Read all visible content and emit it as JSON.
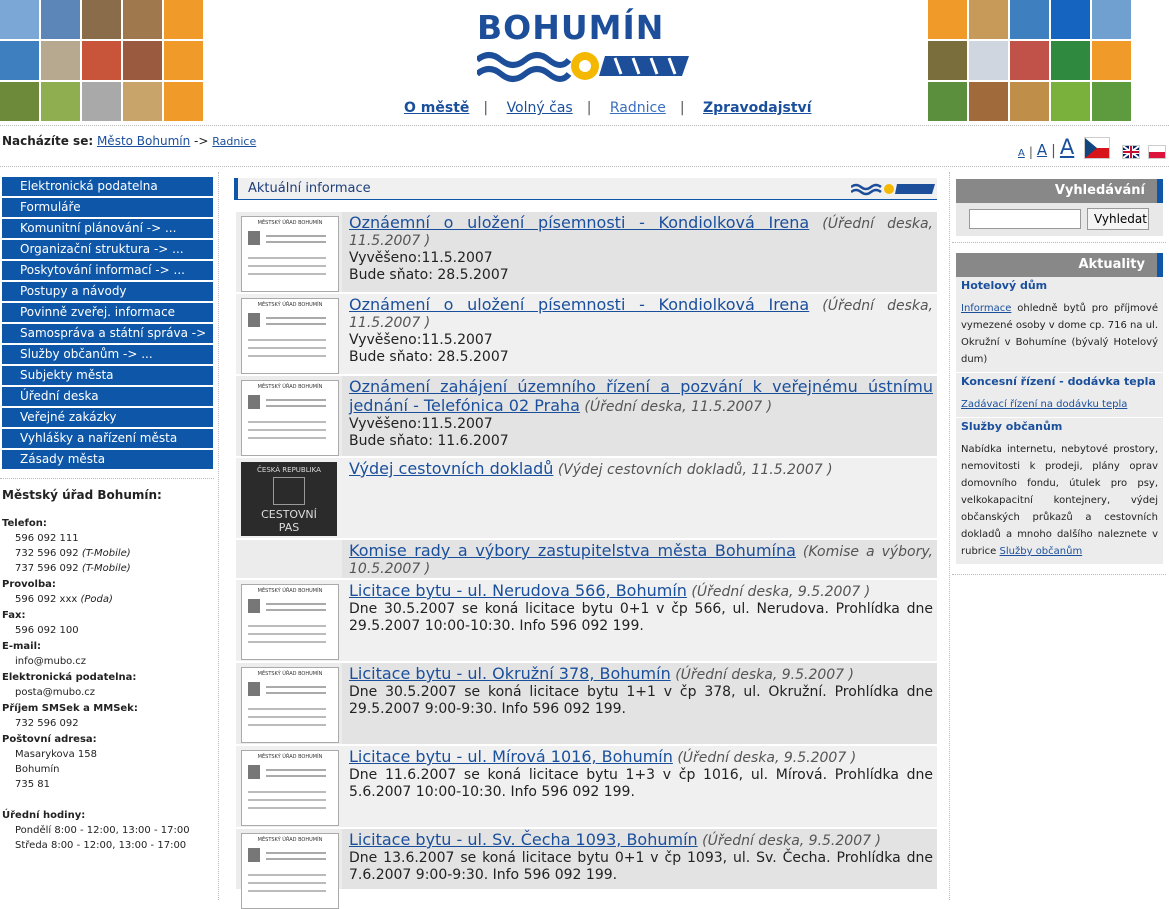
{
  "header": {
    "logo_text": "BOHUMÍN",
    "nav": [
      {
        "label": "O městě"
      },
      {
        "label": "Volný čas"
      },
      {
        "label": "Radnice"
      },
      {
        "label": "Zpravodajství"
      }
    ]
  },
  "breadcrumb": {
    "prefix": "Nacházíte se:",
    "items": [
      "Město Bohumín",
      "Radnice"
    ],
    "separator": "->"
  },
  "font_size_controls": [
    "A",
    "A",
    "A"
  ],
  "left_menu": [
    "Elektronická podatelna",
    "Formuláře",
    "Komunitní plánování  -> ...",
    "Organizační struktura  -> ...",
    "Poskytování informací  -> ...",
    "Postupy a návody",
    "Povinně zveřej. informace",
    "Samospráva a státní správa  ->",
    "Služby občanům  -> ...",
    "Subjekty města",
    "Úřední deska",
    "Veřejné zakázky",
    "Vyhlášky a nařízení města",
    "Zásady města"
  ],
  "contact": {
    "title": "Městský úřad Bohumín:",
    "telefon_label": "Telefon:",
    "telefon": [
      "596 092 111",
      "732 596 092",
      "737 596 092"
    ],
    "telefon_note": "(T-Mobile)",
    "provolba_label": "Provolba:",
    "provolba": "596 092 xxx",
    "provolba_note": "(Poda)",
    "fax_label": "Fax:",
    "fax": "596 092 100",
    "email_label": "E-mail:",
    "email": "info@mubo.cz",
    "podatelna_label": "Elektronická podatelna:",
    "podatelna": "posta@mubo.cz",
    "sms_label": "Příjem SMSek a MMSek:",
    "sms": "732 596 092",
    "address_label": "Poštovní adresa:",
    "address": [
      "Masarykova 158",
      "Bohumín",
      "735 81"
    ],
    "hours_label": "Úřední hodiny:",
    "hours": [
      "Pondělí 8:00 - 12:00, 13:00 - 17:00",
      "Středa 8:00 - 12:00, 13:00 - 17:00"
    ]
  },
  "main": {
    "heading": "Aktuální informace",
    "news": [
      {
        "title": "Oznáemní o uložení písemnosti - Kondiolková Irena",
        "meta": "(Úřední deska, 11.5.2007 )",
        "lines": [
          "Vyvěšeno:11.5.2007",
          "Bude sňato: 28.5.2007"
        ],
        "thumb": "doc"
      },
      {
        "title": "Oznámení o uložení písemnosti - Kondiolková Irena",
        "meta": "(Úřední deska, 11.5.2007 )",
        "lines": [
          "Vyvěšeno:11.5.2007",
          "Bude sňato: 28.5.2007"
        ],
        "thumb": "doc"
      },
      {
        "title": "Oznámení zahájení územního řízení a pozvání k veřejnému ústnímu jednání - Telefónica 02 Praha",
        "meta": "(Úřední deska, 11.5.2007 )",
        "lines": [
          "Vyvěšeno:11.5.2007",
          "Bude sňato: 11.6.2007"
        ],
        "thumb": "doc"
      },
      {
        "title": "Výdej cestovních dokladů",
        "meta": "(Výdej cestovních dokladů, 11.5.2007 )",
        "lines": [],
        "thumb": "pas"
      },
      {
        "title": "Komise rady a výbory zastupitelstva města Bohumína",
        "meta": "(Komise a výbory, 10.5.2007 )",
        "lines": [],
        "thumb": "none"
      },
      {
        "title": "Licitace bytu - ul. Nerudova 566, Bohumín",
        "meta": "(Úřední deska, 9.5.2007 )",
        "lines": [
          "Dne 30.5.2007 se koná licitace bytu 0+1 v čp 566, ul. Nerudova. Prohlídka dne 29.5.2007 10:00-10:30. Info 596 092 199."
        ],
        "thumb": "doc"
      },
      {
        "title": "Licitace bytu - ul. Okružní 378, Bohumín",
        "meta": "(Úřední deska, 9.5.2007 )",
        "lines": [
          "Dne 30.5.2007 se koná licitace bytu 1+1 v čp 378, ul. Okružní. Prohlídka dne 29.5.2007 9:00-9:30. Info 596 092 199."
        ],
        "thumb": "doc"
      },
      {
        "title": "Licitace bytu - ul. Mírová 1016, Bohumín",
        "meta": "(Úřední deska, 9.5.2007 )",
        "lines": [
          "Dne 11.6.2007 se koná licitace bytu 1+3 v čp 1016, ul. Mírová. Prohlídka dne 5.6.2007 10:00-10:30. Info 596 092 199."
        ],
        "thumb": "doc"
      },
      {
        "title": "Licitace bytu - ul. Sv. Čecha 1093, Bohumín",
        "meta": "(Úřední deska, 9.5.2007 )",
        "lines": [
          "Dne 13.6.2007 se koná licitace bytu 0+1 v čp 1093, ul. Sv. Čecha. Prohlídka dne 7.6.2007 9:00-9:30. Info 596 092 199."
        ],
        "thumb": "doc"
      }
    ]
  },
  "thumb_text": {
    "doc_header": "MĚSTSKÝ ÚŘAD BOHUMÍN",
    "pas_top": "ČESKÁ REPUBLIKA",
    "pas_bottom1": "CESTOVNÍ",
    "pas_bottom2": "PAS"
  },
  "right": {
    "search_title": "Vyhledávání",
    "search_value": "",
    "search_button": "Vyhledat",
    "news_title": "Aktuality",
    "sections": [
      {
        "title": "Hotelový dům",
        "link": "Informace",
        "text": "ohledně bytů pro příjmové vymezené osoby v dome cp. 716 na ul. Okružní v Bohumíne (bývalý Hotelový dum)"
      },
      {
        "title": "Koncesní řízení - dodávka tepla",
        "link": "Zadávací řízení na dodávku tepla",
        "text": ""
      },
      {
        "title": "Služby občanům",
        "text": "Nabídka internetu, nebytové prostory, nemovitosti k prodeji, plány oprav domovního fondu, útulek pro psy, velkokapacitní kontejnery, výdej občanských průkazů a cestovních dokladů a mnoho dalšího naleznete v rubrice",
        "link": "Služby občanům"
      }
    ]
  },
  "colors": {
    "brand": "#0e57a8",
    "logo": "#1d4e9a",
    "sun": "#f5b800"
  }
}
